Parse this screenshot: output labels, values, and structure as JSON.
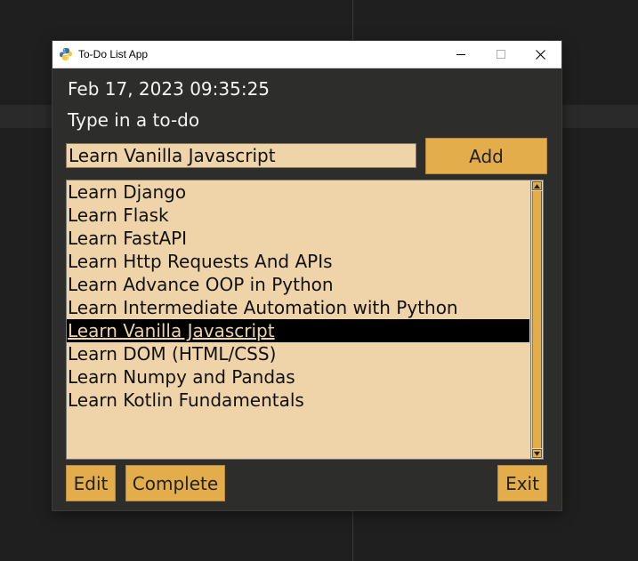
{
  "window": {
    "title": "To-Do List App"
  },
  "header": {
    "datetime": "Feb 17, 2023 09:35:25",
    "prompt": "Type in a to-do"
  },
  "input": {
    "value": "Learn Vanilla Javascript"
  },
  "buttons": {
    "add": "Add",
    "edit": "Edit",
    "complete": "Complete",
    "exit": "Exit"
  },
  "todos": [
    "Learn Django",
    "Learn Flask",
    "Learn FastAPI",
    "Learn Http Requests And APIs",
    "Learn Advance OOP in Python",
    "Learn Intermediate Automation with Python",
    "Learn Vanilla Javascript ",
    "Learn DOM (HTML/CSS)",
    "Learn Numpy and Pandas",
    "Learn Kotlin Fundamentals"
  ],
  "selected_index": 6,
  "colors": {
    "window_bg": "#2d2d2b",
    "accent": "#e3ad4c",
    "field_bg": "#efd4a9",
    "selection": "#000000"
  },
  "icons": {
    "app": "python-icon",
    "minimize": "minimize-icon",
    "maximize": "maximize-icon",
    "close": "close-icon",
    "scroll_up": "arrow-up-icon",
    "scroll_down": "arrow-down-icon"
  }
}
